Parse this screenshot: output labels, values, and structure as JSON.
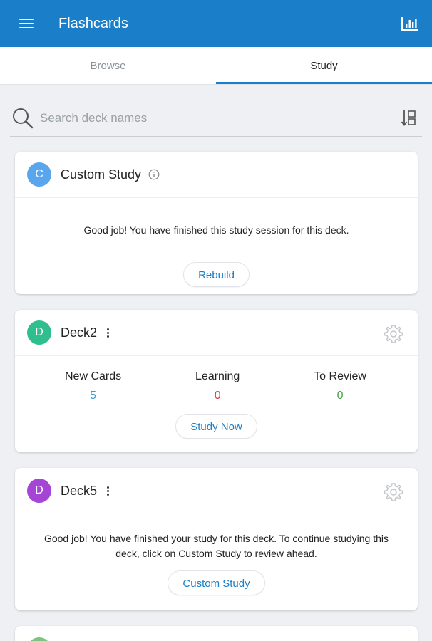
{
  "app": {
    "title": "Flashcards"
  },
  "tabs": [
    {
      "label": "Browse",
      "active": false
    },
    {
      "label": "Study",
      "active": true
    }
  ],
  "search": {
    "placeholder": "Search deck names"
  },
  "colors": {
    "accent": "#1a7fc8",
    "new": "#3a9ad9",
    "learning": "#e53935",
    "review": "#43a047"
  },
  "decks": [
    {
      "initial": "C",
      "name": "Custom Study",
      "avatar_color": "#5aa6ec",
      "message": "Good job! You have finished this study session for this deck.",
      "button": "Rebuild"
    },
    {
      "initial": "D",
      "name": "Deck2",
      "avatar_color": "#2fbf8f",
      "stats": [
        {
          "label": "New Cards",
          "value": "5"
        },
        {
          "label": "Learning",
          "value": "0"
        },
        {
          "label": "To Review",
          "value": "0"
        }
      ],
      "button": "Study Now"
    },
    {
      "initial": "D",
      "name": "Deck5",
      "avatar_color": "#a445d6",
      "message_line1": "Good job! You have finished your study for this deck. To continue studying this",
      "message_line2": "deck, click on Custom Study to review ahead.",
      "button": "Custom Study"
    }
  ]
}
